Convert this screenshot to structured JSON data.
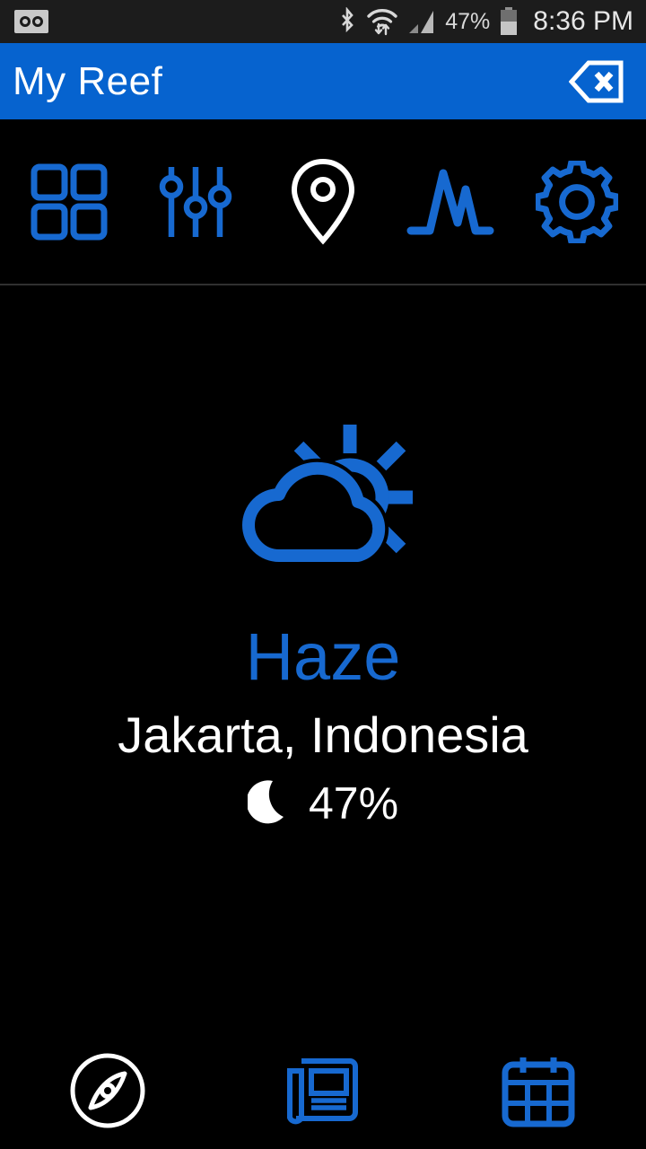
{
  "statusbar": {
    "voicemail_icon": "voicemail-icon",
    "bluetooth_icon": "bluetooth-icon",
    "wifi_icon": "wifi-transfer-icon",
    "signal_icon": "cellular-signal-icon",
    "battery_percent": "47%",
    "battery_icon": "battery-icon",
    "time": "8:36 PM"
  },
  "appbar": {
    "title": "My Reef",
    "action_icon": "backspace-close-icon"
  },
  "toolbar": {
    "items": [
      {
        "name": "dashboard-grid",
        "icon": "grid-icon",
        "active": false
      },
      {
        "name": "controls",
        "icon": "sliders-icon",
        "active": false
      },
      {
        "name": "location",
        "icon": "map-pin-icon",
        "active": true
      },
      {
        "name": "graphs",
        "icon": "peaks-chart-icon",
        "active": false
      },
      {
        "name": "settings",
        "icon": "gear-icon",
        "active": false
      }
    ]
  },
  "main": {
    "weather_icon": "partly-cloudy-icon",
    "condition": "Haze",
    "location": "Jakarta, Indonesia",
    "metric_icon": "crescent-moon-icon",
    "metric_value": "47%"
  },
  "bottombar": {
    "items": [
      {
        "name": "explore",
        "icon": "compass-icon",
        "active": true
      },
      {
        "name": "news",
        "icon": "newspaper-icon",
        "active": false
      },
      {
        "name": "calendar",
        "icon": "calendar-icon",
        "active": false
      }
    ]
  },
  "colors": {
    "accent": "#1769d0",
    "appbar": "#0663cf",
    "background": "#000000",
    "active": "#ffffff",
    "statusbar": "#1c1c1c"
  }
}
